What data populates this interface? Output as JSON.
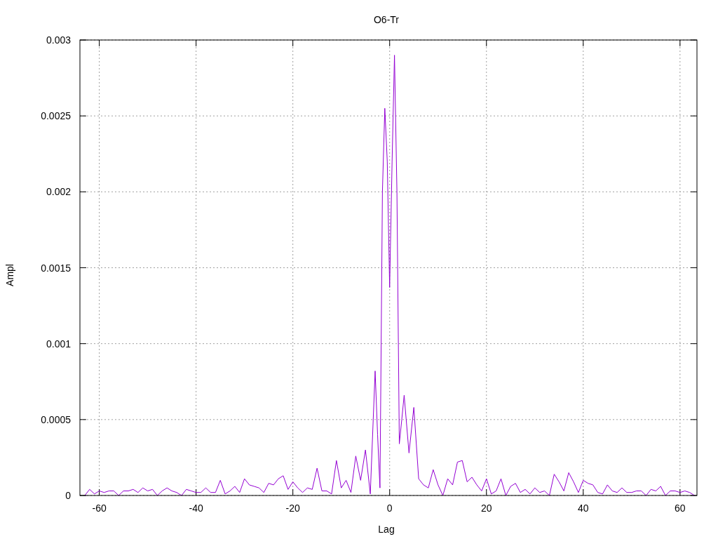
{
  "chart_data": {
    "type": "line",
    "title": "O6-Tr",
    "xlabel": "Lag",
    "ylabel": "Ampl",
    "xlim": [
      -64,
      63.5
    ],
    "ylim": [
      0,
      0.003
    ],
    "xticks": [
      -60,
      -40,
      -20,
      0,
      20,
      40,
      60
    ],
    "yticks": [
      0,
      0.0005,
      0.001,
      0.0015,
      0.002,
      0.0025,
      0.003
    ],
    "x": [
      -63,
      -62,
      -61,
      -60,
      -59,
      -58,
      -57,
      -56,
      -55,
      -54,
      -53,
      -52,
      -51,
      -50,
      -49,
      -48,
      -47,
      -46,
      -45,
      -44,
      -43,
      -42,
      -41,
      -40,
      -39,
      -38,
      -37,
      -36,
      -35,
      -34,
      -33,
      -32,
      -31,
      -30,
      -29,
      -28,
      -27,
      -26,
      -25,
      -24,
      -23,
      -22,
      -21,
      -20,
      -19,
      -18,
      -17,
      -16,
      -15,
      -14,
      -13,
      -12,
      -11,
      -10,
      -9,
      -8,
      -7,
      -6,
      -5,
      -4,
      -3,
      -2.5,
      -2,
      -1.5,
      -1,
      -0.5,
      0,
      0.5,
      1,
      1.5,
      2,
      2.5,
      3,
      4,
      5,
      6,
      7,
      8,
      9,
      10,
      11,
      12,
      13,
      14,
      15,
      16,
      17,
      18,
      19,
      20,
      21,
      22,
      23,
      24,
      25,
      26,
      27,
      28,
      29,
      30,
      31,
      32,
      33,
      34,
      35,
      36,
      37,
      38,
      39,
      40,
      41,
      42,
      43,
      44,
      45,
      46,
      47,
      48,
      49,
      50,
      51,
      52,
      53,
      54,
      55,
      56,
      57,
      58,
      59,
      60,
      61,
      62,
      63
    ],
    "grid": true,
    "series": [
      {
        "color": "#9400d3",
        "values": [
          0,
          4e-05,
          1e-05,
          3e-05,
          2e-05,
          3e-05,
          3e-05,
          0,
          3e-05,
          3e-05,
          4e-05,
          2e-05,
          5e-05,
          3e-05,
          4e-05,
          0,
          3e-05,
          5e-05,
          3e-05,
          2e-05,
          0,
          4e-05,
          3e-05,
          2e-05,
          2e-05,
          5e-05,
          2e-05,
          2e-05,
          0.0001,
          1e-05,
          3e-05,
          6e-05,
          2e-05,
          0.00011,
          7e-05,
          6e-05,
          5e-05,
          2e-05,
          8e-05,
          7e-05,
          0.00011,
          0.00013,
          4e-05,
          9e-05,
          5e-05,
          2e-05,
          5e-05,
          4e-05,
          0.00018,
          3e-05,
          3e-05,
          1e-05,
          0.00023,
          5e-05,
          0.0001,
          2e-05,
          0.00026,
          0.0001,
          0.0003,
          1e-05,
          0.00082,
          0.0004,
          5e-05,
          0.002,
          0.00255,
          0.0022,
          0.00137,
          0.0022,
          0.0029,
          0.002,
          0.00034,
          0.0005,
          0.00066,
          0.00028,
          0.00058,
          0.00011,
          7e-05,
          5e-05,
          0.00017,
          7e-05,
          0,
          0.00011,
          7e-05,
          0.00022,
          0.00023,
          9e-05,
          0.00012,
          7e-05,
          3e-05,
          0.00011,
          1e-05,
          3e-05,
          0.00011,
          0,
          6e-05,
          8e-05,
          2e-05,
          4e-05,
          1e-05,
          5e-05,
          2e-05,
          3e-05,
          0,
          0.00014,
          9e-05,
          3e-05,
          0.00015,
          9e-05,
          2e-05,
          0.0001,
          8e-05,
          7e-05,
          2e-05,
          1e-05,
          7e-05,
          3e-05,
          2e-05,
          5e-05,
          2e-05,
          2e-05,
          3e-05,
          3e-05,
          0,
          4e-05,
          3e-05,
          6e-05,
          0,
          3e-05,
          3e-05,
          2e-05,
          3e-05,
          2e-05,
          0
        ]
      }
    ]
  }
}
